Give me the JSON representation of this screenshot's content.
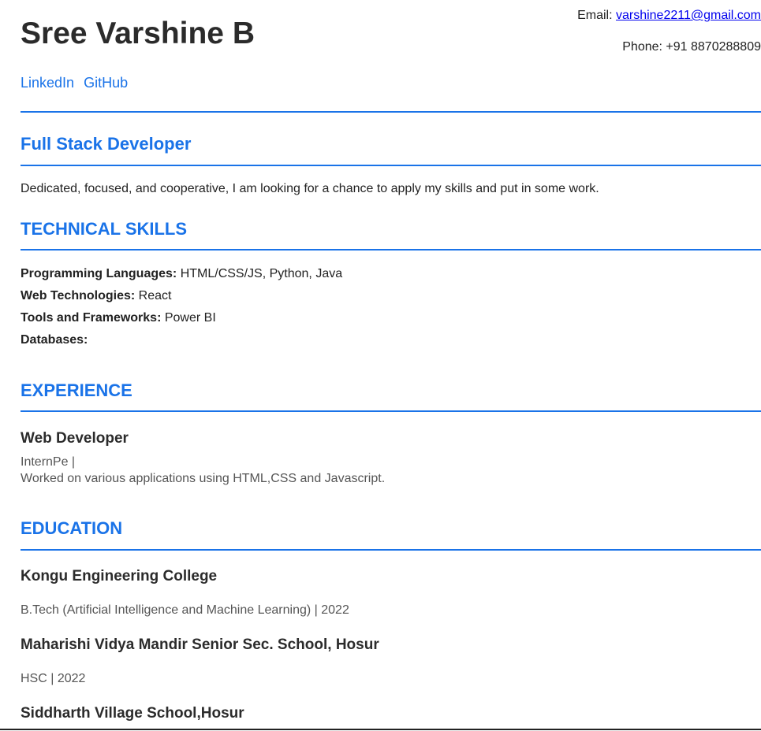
{
  "header": {
    "name": "Sree Varshine B",
    "email_label": "Email:",
    "email": "varshine2211@gmail.com",
    "phone_label": "Phone:",
    "phone": "+91 8870288809",
    "links": [
      "LinkedIn",
      "GitHub"
    ]
  },
  "role": "Full Stack Developer",
  "summary": "Dedicated, focused, and cooperative, I am looking for a chance to apply my skills and put in some work.",
  "skills": {
    "heading": "TECHNICAL SKILLS",
    "items": [
      {
        "label": "Programming Languages:",
        "value": "HTML/CSS/JS, Python, Java"
      },
      {
        "label": "Web Technologies:",
        "value": "React"
      },
      {
        "label": "Tools and Frameworks:",
        "value": "Power BI"
      },
      {
        "label": "Databases:",
        "value": ""
      }
    ]
  },
  "experience": {
    "heading": "EXPERIENCE",
    "items": [
      {
        "title": "Web Developer",
        "company": "InternPe |",
        "description": "Worked on various applications using HTML,CSS and Javascript."
      }
    ]
  },
  "education": {
    "heading": "EDUCATION",
    "items": [
      {
        "school": "Kongu Engineering College",
        "detail": "B.Tech (Artificial Intelligence and Machine Learning) | 2022"
      },
      {
        "school": "Maharishi Vidya Mandir Senior Sec. School, Hosur",
        "detail": "HSC | 2022"
      },
      {
        "school": "Siddharth Village School,Hosur",
        "detail": ""
      }
    ]
  }
}
